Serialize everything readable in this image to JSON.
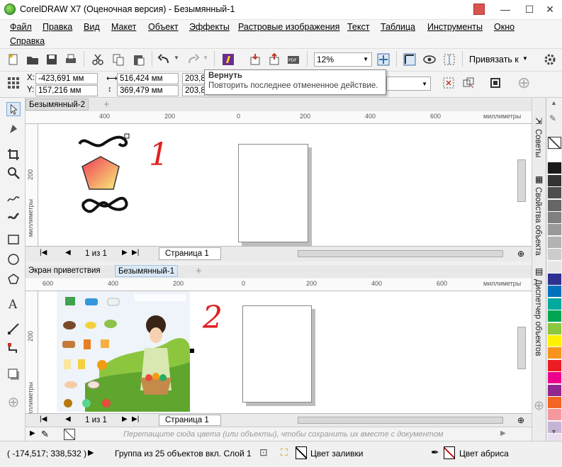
{
  "title_bar": {
    "title": "CorelDRAW X7 (Оценочная версия) - Безымянный-1",
    "minimize": "—",
    "maximize": "☐",
    "close": "✕"
  },
  "menu": {
    "file": "Файл",
    "edit": "Правка",
    "view": "Вид",
    "layout": "Макет",
    "object": "Объект",
    "effects": "Эффекты",
    "bitmaps": "Растровые изображения",
    "text": "Текст",
    "table": "Таблица",
    "tools": "Инструменты",
    "window": "Окно",
    "help": "Справка"
  },
  "toolbar": {
    "zoom_value": "12%",
    "snap_label": "Привязать к"
  },
  "propbar": {
    "x_label": "X:",
    "x_value": "-423,691 мм",
    "y_label": "Y:",
    "y_value": "157,216 мм",
    "w_value": "516,424 мм",
    "h_value": "369,479 мм",
    "sx_value": "203,8",
    "sy_value": "203,8"
  },
  "tooltip": {
    "title": "Вернуть",
    "text": "Повторить последнее отмененное действие."
  },
  "window1": {
    "tab": "Безымянный-2",
    "ruler_ticks": [
      "400",
      "200",
      "0",
      "200",
      "400",
      "600"
    ],
    "ruler_unit": "миллиметры",
    "vruler_label": "200",
    "vruler_unit": "миллиметры",
    "page_counter": "1 из 1",
    "page_tab": "Страница 1",
    "annotation": "1"
  },
  "window2": {
    "tab_welcome": "Экран приветствия",
    "tab_doc": "Безымянный-1",
    "ruler_ticks": [
      "600",
      "400",
      "200",
      "0",
      "200",
      "400",
      "600"
    ],
    "ruler_unit": "миллиметры",
    "vruler_label": "200",
    "vruler_unit": "миллиметры",
    "page_counter": "1 из 1",
    "page_tab": "Страница 1",
    "annotation": "2"
  },
  "right_panel": {
    "tab_hints": "Советы",
    "tab_properties": "Свойства объекта",
    "tab_objects": "Диспетчер объектов"
  },
  "palette_colors": [
    "#ffffff",
    "#1a1a1a",
    "#333333",
    "#4d4d4d",
    "#666666",
    "#808080",
    "#999999",
    "#b3b3b3",
    "#cccccc",
    "#e6e6e6",
    "#2e3192",
    "#0071bc",
    "#00a99d",
    "#00a651",
    "#8dc63f",
    "#fff200",
    "#f7941d",
    "#ed1c24",
    "#ec008c",
    "#92278f",
    "#f26522",
    "#f5989d",
    "#c4b5d6",
    "#e8e0f0"
  ],
  "color_strip_hint": "Перетащите сюда цвета (или объекты), чтобы сохранить их вместе с документом",
  "status": {
    "coords": "( -174,517; 338,532 )",
    "object_info": "Группа из 25 объектов вкл. Слой 1",
    "fill": "Цвет заливки",
    "outline": "Цвет абриса"
  }
}
